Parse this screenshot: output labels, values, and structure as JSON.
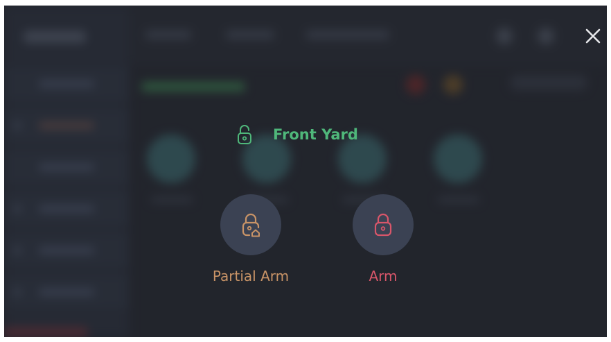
{
  "modal": {
    "title": "Front Yard",
    "title_color": "#4fb77a",
    "status_icon": "unlocked-padlock-icon",
    "close_icon": "close-icon",
    "actions": [
      {
        "label": "Partial Arm",
        "icon": "padlock-home-icon",
        "color": "#c99467"
      },
      {
        "label": "Arm",
        "icon": "padlock-icon",
        "color": "#d9566a"
      }
    ]
  },
  "colors": {
    "background": "#272a33",
    "action_circle": "#3b4253"
  }
}
